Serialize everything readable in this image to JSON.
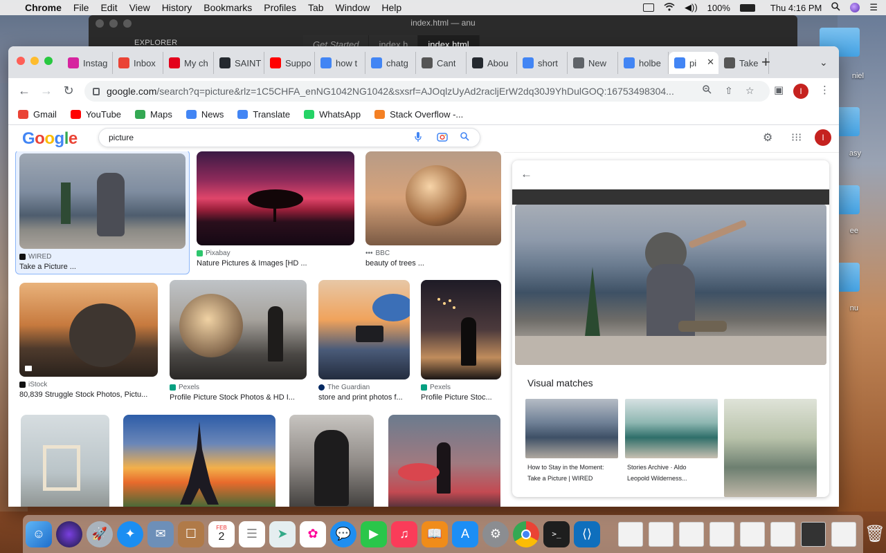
{
  "menubar": {
    "app": "Chrome",
    "items": [
      "File",
      "Edit",
      "View",
      "History",
      "Bookmarks",
      "Profiles",
      "Tab",
      "Window",
      "Help"
    ],
    "battery": "100%",
    "clock": "Thu 4:16 PM"
  },
  "vscode": {
    "title": "index.html — anu",
    "explorer": "EXPLORER",
    "tabs": [
      "Get Started",
      "index.h",
      "index.html"
    ]
  },
  "chrome": {
    "tabs": [
      {
        "label": "Instag",
        "icon": "instagram-icon",
        "color": "#d6249f"
      },
      {
        "label": "Inbox",
        "icon": "gmail-icon",
        "color": "#ea4335"
      },
      {
        "label": "My ch",
        "icon": "opera-icon",
        "color": "#e3001b"
      },
      {
        "label": "SAINT",
        "icon": "github-icon",
        "color": "#24292f"
      },
      {
        "label": "Suppo",
        "icon": "youtube-icon",
        "color": "#ff0000"
      },
      {
        "label": "how t",
        "icon": "google-icon",
        "color": "#4285f4"
      },
      {
        "label": "chatg",
        "icon": "google-icon",
        "color": "#4285f4"
      },
      {
        "label": "Cant",
        "icon": "apple-icon",
        "color": "#555555"
      },
      {
        "label": "Abou",
        "icon": "github-icon",
        "color": "#24292f"
      },
      {
        "label": "short",
        "icon": "google-icon",
        "color": "#4285f4"
      },
      {
        "label": "New",
        "icon": "chrome-icon",
        "color": "#5f6368"
      },
      {
        "label": "holbe",
        "icon": "google-icon",
        "color": "#4285f4"
      },
      {
        "label": "pi",
        "icon": "google-icon",
        "color": "#4285f4"
      },
      {
        "label": "Take",
        "icon": "apple-icon",
        "color": "#555555"
      }
    ],
    "url_host": "google.com",
    "url_rest": "/search?q=picture&rlz=1C5CHFA_enNG1042NG1042&sxsrf=AJOqlzUyAd2racljErW2dq30J9YhDulGOQ:16753498304...",
    "profile_initial": "I",
    "bookmarks": [
      {
        "label": "Gmail",
        "color": "#ea4335"
      },
      {
        "label": "YouTube",
        "color": "#ff0000"
      },
      {
        "label": "Maps",
        "color": "#34a853"
      },
      {
        "label": "News",
        "color": "#4285f4"
      },
      {
        "label": "Translate",
        "color": "#4285f4"
      },
      {
        "label": "WhatsApp",
        "color": "#25d366"
      },
      {
        "label": "Stack Overflow -...",
        "color": "#f48024"
      }
    ]
  },
  "google": {
    "logo": "Google",
    "query": "picture",
    "profile_initial": "I"
  },
  "results": [
    {
      "source": "WIRED",
      "title": "Take a Picture ...",
      "selected": true
    },
    {
      "source": "Pixabay",
      "title": "Nature Pictures & Images [HD ..."
    },
    {
      "source": "BBC",
      "title": "beauty of trees ..."
    },
    {
      "source": "iStock",
      "title": "80,839 Struggle Stock Photos, Pictu..."
    },
    {
      "source": "Pexels",
      "title": "Profile Picture Stock Photos & HD I..."
    },
    {
      "source": "The Guardian",
      "title": "store and print photos f..."
    },
    {
      "source": "Pexels",
      "title": "Profile Picture Stoc..."
    }
  ],
  "panel": {
    "visual_matches_title": "Visual matches",
    "matches": [
      {
        "line1": "How to Stay in the Moment:",
        "line2": "Take a Picture | WIRED"
      },
      {
        "line1": "Stories Archive · Aldo",
        "line2": "Leopold Wilderness..."
      },
      {
        "line1": "",
        "line2": ""
      }
    ]
  },
  "desktop": {
    "labels": [
      "niel",
      "asy",
      "ee",
      "nu"
    ]
  },
  "dock": {
    "calendar_month": "FEB",
    "calendar_day": "2"
  }
}
